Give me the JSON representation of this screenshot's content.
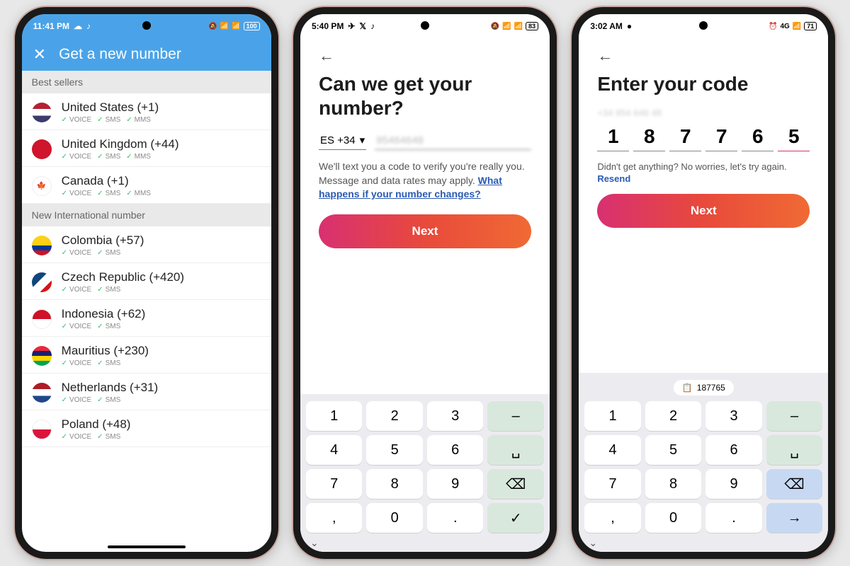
{
  "phone1": {
    "status": {
      "time": "11:41 PM",
      "battery": "100"
    },
    "title": "Get a new number",
    "sections": [
      {
        "label": "Best sellers",
        "items": [
          {
            "name": "United States (+1)",
            "flag": "us",
            "tags": [
              "VOICE",
              "SMS",
              "MMS"
            ]
          },
          {
            "name": "United Kingdom (+44)",
            "flag": "uk",
            "tags": [
              "VOICE",
              "SMS",
              "MMS"
            ]
          },
          {
            "name": "Canada (+1)",
            "flag": "ca",
            "tags": [
              "VOICE",
              "SMS",
              "MMS"
            ]
          }
        ]
      },
      {
        "label": "New International number",
        "items": [
          {
            "name": "Colombia (+57)",
            "flag": "co",
            "tags": [
              "VOICE",
              "SMS"
            ]
          },
          {
            "name": "Czech Republic (+420)",
            "flag": "cz",
            "tags": [
              "VOICE",
              "SMS"
            ]
          },
          {
            "name": "Indonesia (+62)",
            "flag": "id",
            "tags": [
              "VOICE",
              "SMS"
            ]
          },
          {
            "name": "Mauritius (+230)",
            "flag": "mu",
            "tags": [
              "VOICE",
              "SMS"
            ]
          },
          {
            "name": "Netherlands (+31)",
            "flag": "nl",
            "tags": [
              "VOICE",
              "SMS"
            ]
          },
          {
            "name": "Poland (+48)",
            "flag": "pl",
            "tags": [
              "VOICE",
              "SMS"
            ]
          }
        ]
      }
    ]
  },
  "phone2": {
    "status": {
      "time": "5:40 PM",
      "battery": "83"
    },
    "heading": "Can we get your number?",
    "country_code": "ES +34",
    "phone_placeholder": "95464648",
    "desc_prefix": "We'll text you a code to verify you're really you. Message and data rates may apply. ",
    "desc_link": "What happens if your number changes?",
    "next": "Next",
    "keypad": {
      "keys": [
        "1",
        "2",
        "3",
        "–",
        "4",
        "5",
        "6",
        "␣",
        "7",
        "8",
        "9",
        "⌫",
        ",",
        "0",
        ".",
        "✓"
      ],
      "util_positions": [
        3,
        7,
        11,
        15
      ]
    }
  },
  "phone3": {
    "status": {
      "time": "3:02 AM",
      "battery": "71"
    },
    "heading": "Enter your code",
    "subtitle_blurred": "+34 954 646 48",
    "code": [
      "1",
      "8",
      "7",
      "7",
      "6",
      "5"
    ],
    "no_code_text": "Didn't get anything? No worries, let's try again.",
    "resend": "Resend",
    "next": "Next",
    "suggestion": "187765",
    "keypad": {
      "keys": [
        "1",
        "2",
        "3",
        "–",
        "4",
        "5",
        "6",
        "␣",
        "7",
        "8",
        "9",
        "⌫",
        ",",
        "0",
        ".",
        "→"
      ],
      "util_positions": [
        3,
        7,
        11,
        15
      ],
      "blue_positions": [
        11,
        15
      ]
    }
  }
}
